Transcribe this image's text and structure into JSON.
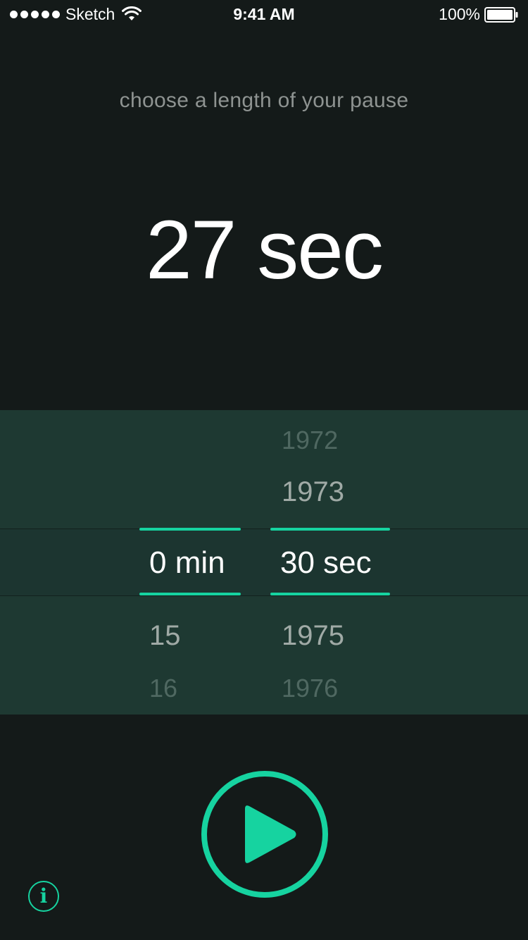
{
  "status_bar": {
    "carrier": "Sketch",
    "time": "9:41 AM",
    "battery": "100%"
  },
  "prompt": "choose a length of your pause",
  "display": {
    "value": "27",
    "unit": "sec"
  },
  "picker": {
    "minutes": {
      "selected": "0 min",
      "below": [
        "15",
        "16"
      ]
    },
    "seconds": {
      "above": [
        "1972",
        "1973"
      ],
      "selected": "30 sec",
      "below": [
        "1975",
        "1976"
      ]
    }
  },
  "info": {
    "glyph": "i"
  },
  "colors": {
    "accent": "#16d3a0",
    "background": "#141a19",
    "picker_bg": "#1e3932"
  },
  "icons": {
    "play": "play-icon",
    "info": "info-icon",
    "wifi": "wifi-icon",
    "battery": "battery-icon"
  }
}
